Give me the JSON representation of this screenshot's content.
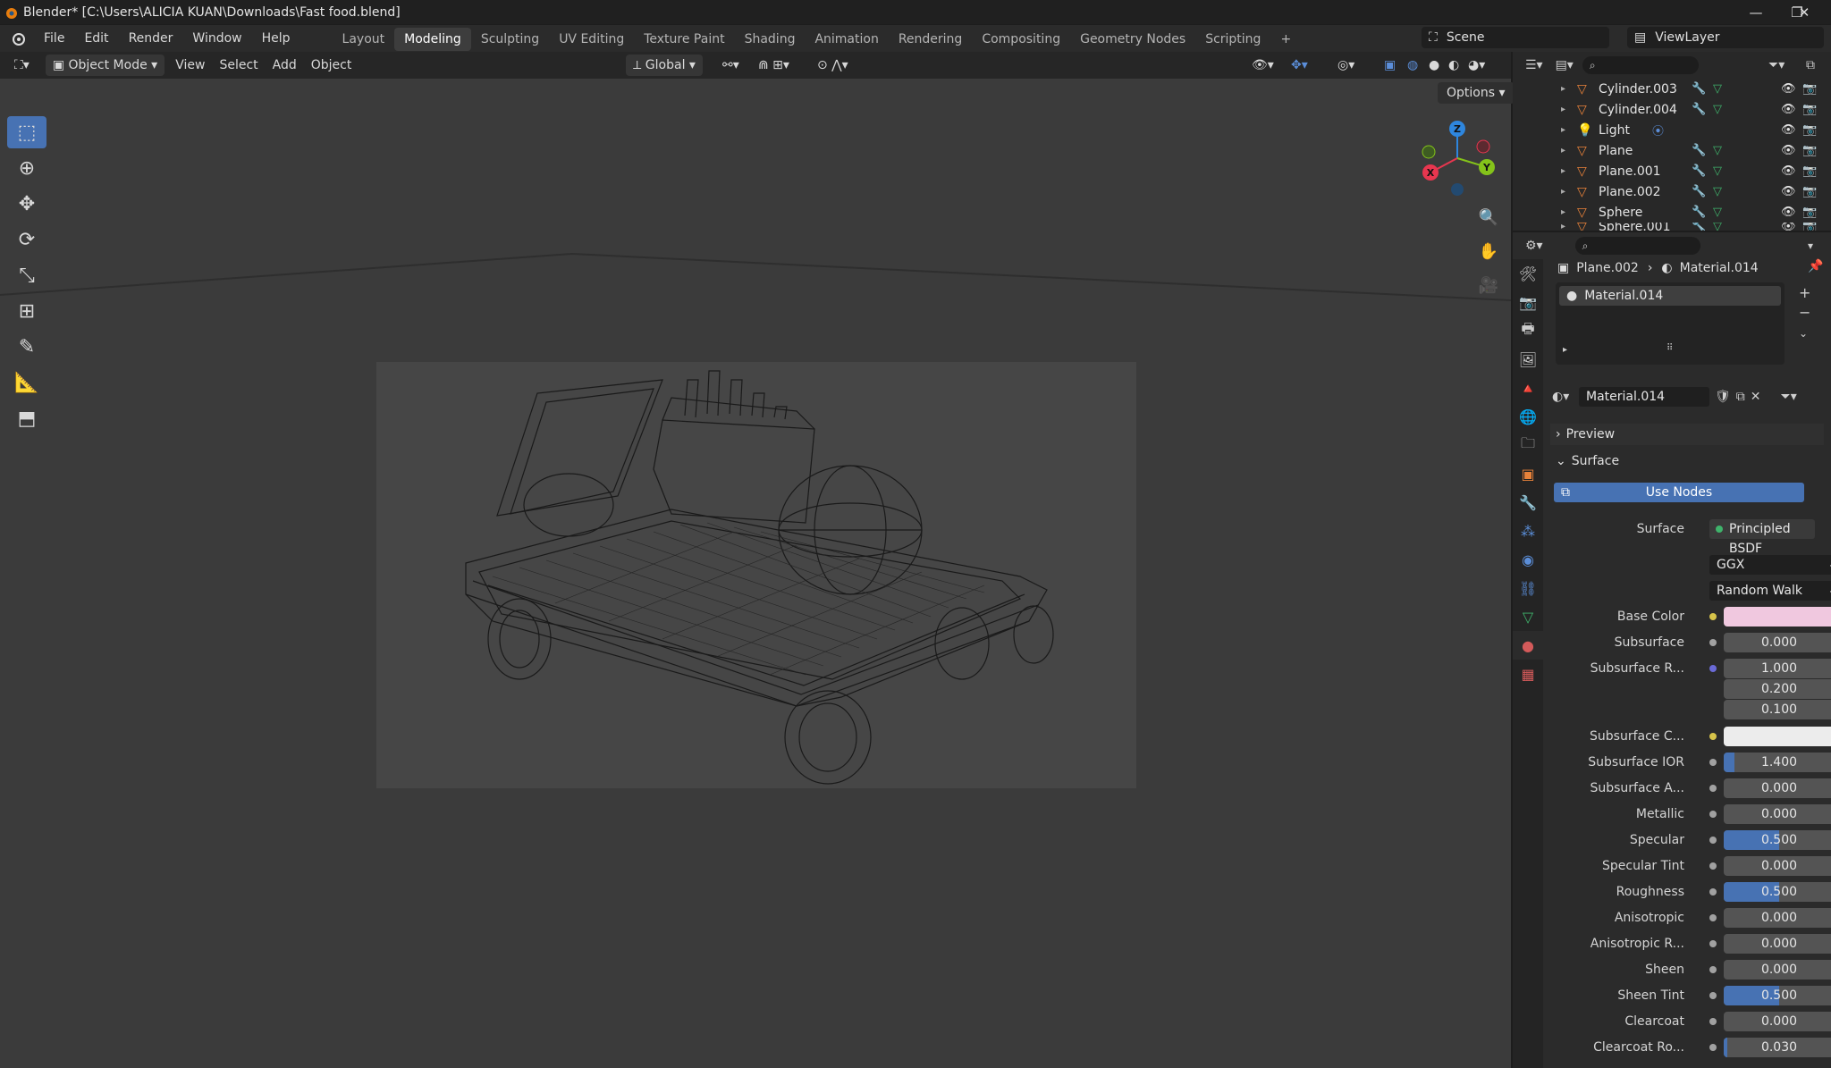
{
  "titlebar": {
    "title": "Blender* [C:\\Users\\ALICIA KUAN\\Downloads\\Fast food.blend]"
  },
  "menus": [
    "File",
    "Edit",
    "Render",
    "Window",
    "Help"
  ],
  "workspaces": [
    "Layout",
    "Modeling",
    "Sculpting",
    "UV Editing",
    "Texture Paint",
    "Shading",
    "Animation",
    "Rendering",
    "Compositing",
    "Geometry Nodes",
    "Scripting"
  ],
  "active_workspace": "Modeling",
  "scene": "Scene",
  "view_layer": "ViewLayer",
  "header3d": {
    "mode": "Object Mode",
    "menus": [
      "View",
      "Select",
      "Add",
      "Object"
    ],
    "orientation": "Global",
    "options": "Options"
  },
  "gizmo": {
    "z": "Z",
    "y": "Y",
    "x": "X"
  },
  "outliner": {
    "items": [
      {
        "name": "Cylinder.003",
        "icon": "mesh-icon",
        "color": "#e8823a"
      },
      {
        "name": "Cylinder.004",
        "icon": "mesh-icon",
        "color": "#e8823a"
      },
      {
        "name": "Light",
        "icon": "light-icon",
        "color": "#e8823a"
      },
      {
        "name": "Plane",
        "icon": "mesh-icon",
        "color": "#e8823a"
      },
      {
        "name": "Plane.001",
        "icon": "mesh-icon",
        "color": "#e8823a"
      },
      {
        "name": "Plane.002",
        "icon": "mesh-icon",
        "color": "#e8823a"
      },
      {
        "name": "Sphere",
        "icon": "mesh-icon",
        "color": "#e8823a"
      },
      {
        "name": "Sphere.001",
        "icon": "mesh-icon",
        "color": "#e8823a"
      }
    ]
  },
  "properties": {
    "breadcrumb": {
      "object": "Plane.002",
      "material": "Material.014"
    },
    "slot": "Material.014",
    "material_name": "Material.014",
    "preview_label": "Preview",
    "surface_label": "Surface",
    "use_nodes": "Use Nodes",
    "surface_field_label": "Surface",
    "surface_shader": "Principled BSDF",
    "distribution": "GGX",
    "subsurface_method": "Random Walk",
    "rows": [
      {
        "label": "Base Color",
        "type": "color",
        "color": "#f0c8df",
        "dot": "#d6c34a"
      },
      {
        "label": "Subsurface",
        "value": "0.000",
        "fill": 0
      },
      {
        "label": "Subsurface R...",
        "value": "1.000",
        "fill": 0,
        "dot": "#6a6ad6"
      },
      {
        "label": "",
        "value": "0.200",
        "fill": 0,
        "nodot": true
      },
      {
        "label": "",
        "value": "0.100",
        "fill": 0,
        "nodot": true
      },
      {
        "label": "Subsurface C...",
        "type": "color",
        "color": "#ececec",
        "dot": "#d6c34a"
      },
      {
        "label": "Subsurface IOR",
        "value": "1.400",
        "fill": 0.1
      },
      {
        "label": "Subsurface A...",
        "value": "0.000",
        "fill": 0
      },
      {
        "label": "Metallic",
        "value": "0.000",
        "fill": 0
      },
      {
        "label": "Specular",
        "value": "0.500",
        "fill": 0.5
      },
      {
        "label": "Specular Tint",
        "value": "0.000",
        "fill": 0
      },
      {
        "label": "Roughness",
        "value": "0.500",
        "fill": 0.5
      },
      {
        "label": "Anisotropic",
        "value": "0.000",
        "fill": 0
      },
      {
        "label": "Anisotropic R...",
        "value": "0.000",
        "fill": 0
      },
      {
        "label": "Sheen",
        "value": "0.000",
        "fill": 0
      },
      {
        "label": "Sheen Tint",
        "value": "0.500",
        "fill": 0.5
      },
      {
        "label": "Clearcoat",
        "value": "0.000",
        "fill": 0
      },
      {
        "label": "Clearcoat Ro...",
        "value": "0.030",
        "fill": 0.03
      }
    ]
  },
  "colors": {
    "accent": "#4772b3",
    "object": "#e8823a",
    "x_axis": "#e8364f",
    "y_axis": "#84c31a",
    "z_axis": "#2e86de"
  }
}
